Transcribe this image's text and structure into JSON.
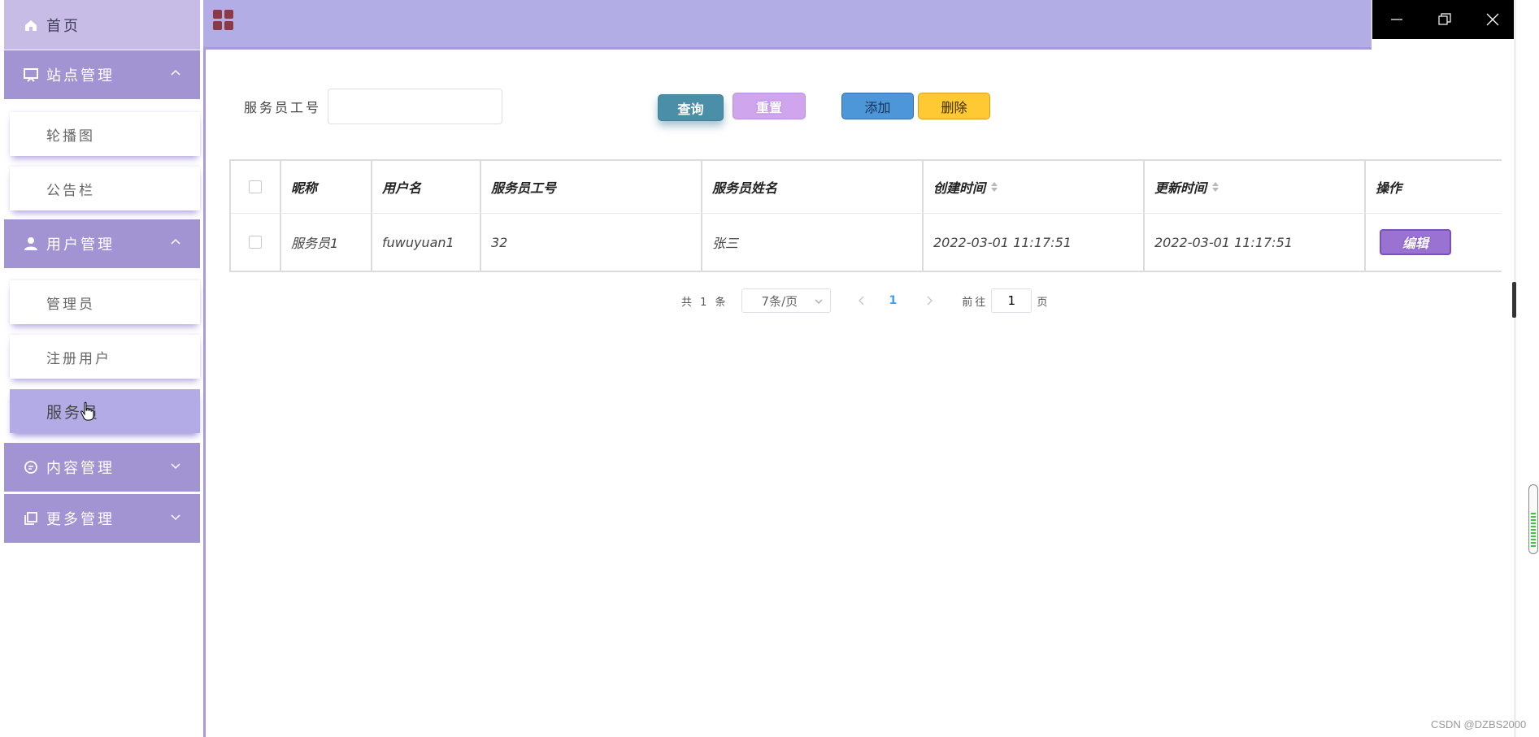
{
  "sidebar": {
    "home": "首页",
    "groups": [
      {
        "label": "站点管理",
        "items": [
          "轮播图",
          "公告栏"
        ]
      },
      {
        "label": "用户管理",
        "items": [
          "管理员",
          "注册用户",
          "服务员"
        ]
      },
      {
        "label": "内容管理"
      },
      {
        "label": "更多管理"
      }
    ],
    "active_item": "服务员"
  },
  "search": {
    "label": "服务员工号",
    "value": "",
    "query_button": "查询",
    "reset_button": "重置",
    "add_button": "添加",
    "delete_button": "删除"
  },
  "table": {
    "headers": [
      "昵称",
      "用户名",
      "服务员工号",
      "服务员姓名",
      "创建时间",
      "更新时间",
      "操作"
    ],
    "rows": [
      {
        "nickname": "服务员1",
        "username": "fuwuyuan1",
        "staff_no": "32",
        "name": "张三",
        "created": "2022-03-01 11:17:51",
        "updated": "2022-03-01 11:17:51",
        "action": "编辑"
      }
    ]
  },
  "pagination": {
    "total": "共 1 条",
    "page_size": "7条/页",
    "current_page": "1",
    "goto_label": "前往",
    "goto_value": "1",
    "page_suffix": "页"
  },
  "watermark": "CSDN @DZBS2000",
  "colors": {
    "sidebar_group": "#a294d2",
    "topbar": "#b2aee5",
    "accent": "#9a73d2"
  }
}
